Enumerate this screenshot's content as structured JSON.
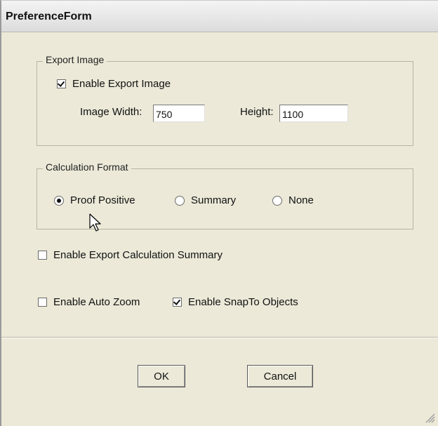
{
  "window": {
    "title": "PreferenceForm"
  },
  "export_image": {
    "legend": "Export Image",
    "enable_label": "Enable Export Image",
    "enable_checked": true,
    "width_label": "Image Width:",
    "width_value": "750",
    "height_label": "Height:",
    "height_value": "1100"
  },
  "calculation_format": {
    "legend": "Calculation Format",
    "options": [
      {
        "label": "Proof Positive",
        "selected": true
      },
      {
        "label": "Summary",
        "selected": false
      },
      {
        "label": "None",
        "selected": false
      }
    ]
  },
  "options": {
    "export_calc_summary_label": "Enable Export Calculation Summary",
    "export_calc_summary_checked": false,
    "auto_zoom_label": "Enable Auto Zoom",
    "auto_zoom_checked": false,
    "snap_to_objects_label": "Enable SnapTo Objects",
    "snap_to_objects_checked": true
  },
  "buttons": {
    "ok": "OK",
    "cancel": "Cancel"
  },
  "icons": {
    "cursor": "mouse-pointer-icon",
    "grip": "resize-grip-icon",
    "check": "check-mark-icon",
    "radio": "radio-dot-icon"
  }
}
